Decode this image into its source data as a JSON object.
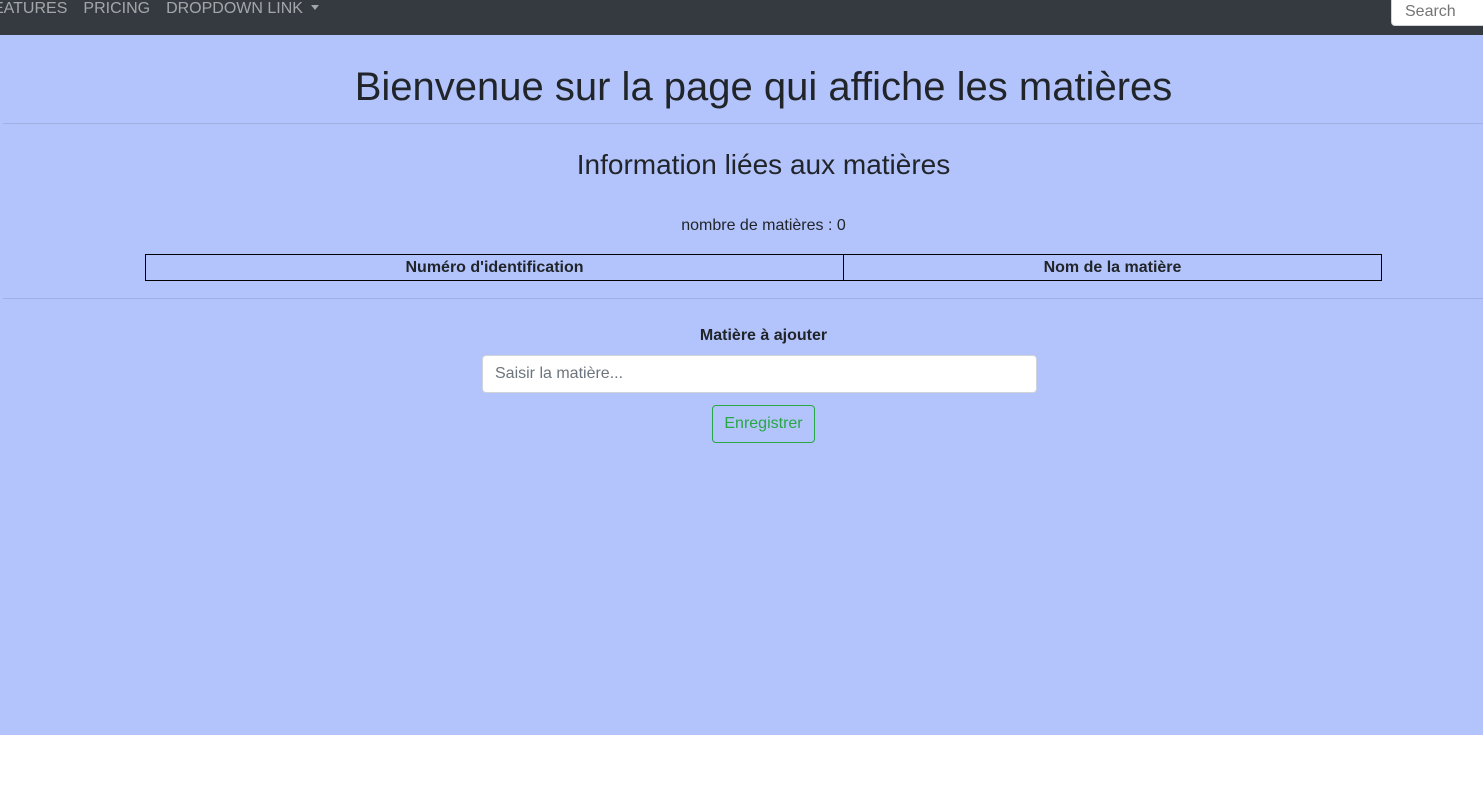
{
  "navbar": {
    "links": [
      {
        "label": "EATURES"
      },
      {
        "label": "PRICING"
      },
      {
        "label": "DROPDOWN LINK"
      }
    ],
    "search_placeholder": "Search"
  },
  "main": {
    "title": "Bienvenue sur la page qui affiche les matières",
    "section_title": "Information liées aux matières",
    "count_label": "nombre de matières : 0",
    "table": {
      "columns": [
        "Numéro d'identification",
        "Nom de la matière"
      ],
      "rows": []
    },
    "form": {
      "label": "Matière à ajouter",
      "input_placeholder": "Saisir la matière...",
      "input_value": "",
      "submit_label": "Enregistrer"
    }
  },
  "colors": {
    "navbar_bg": "#343a40",
    "page_bg": "#b3c4fd",
    "success_accent": "#28a745"
  }
}
